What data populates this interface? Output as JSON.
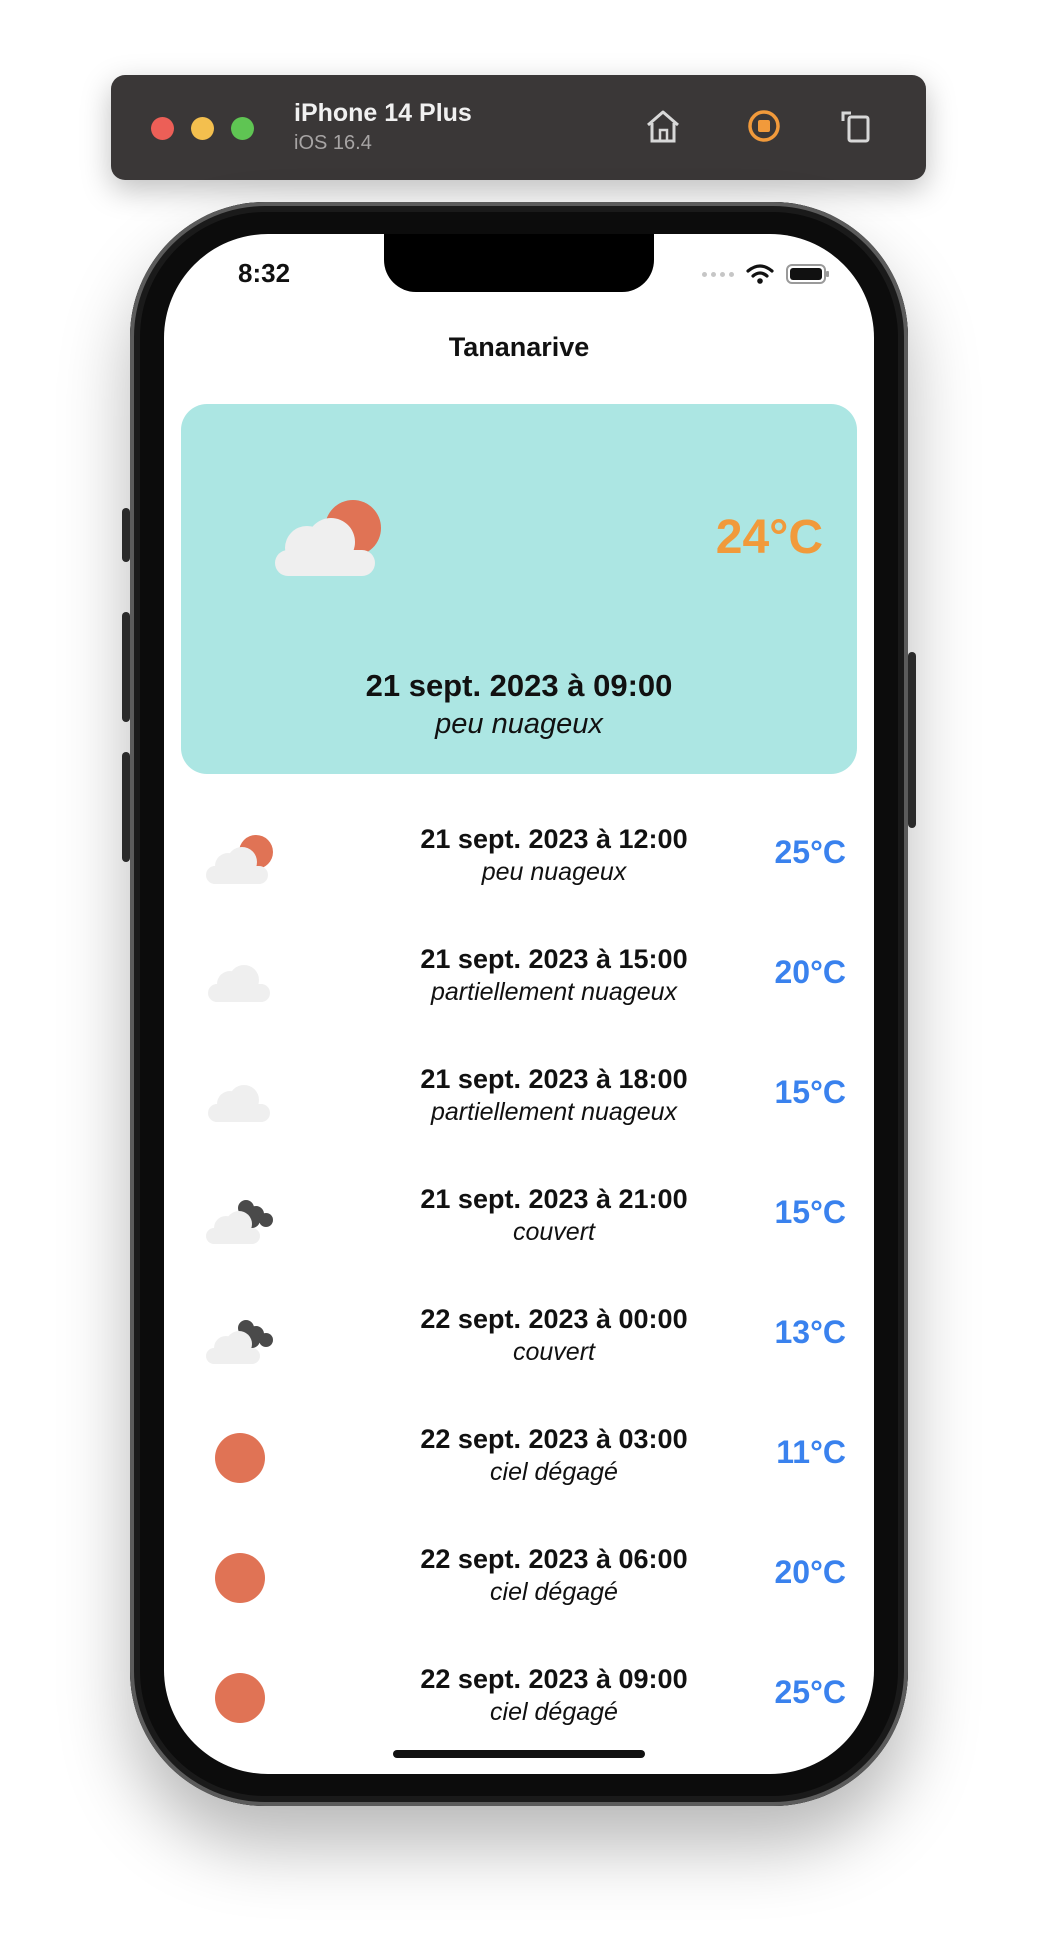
{
  "simulator": {
    "device": "iPhone 14 Plus",
    "os": "iOS 16.4",
    "icons": [
      "home-icon",
      "stop-record-icon",
      "rotate-icon"
    ],
    "accent": "#f19a3b"
  },
  "status_bar": {
    "time": "8:32"
  },
  "nav": {
    "title": "Tananarive"
  },
  "current": {
    "icon": "sun-behind-cloud-icon",
    "temperature": "24°C",
    "datetime": "21 sept. 2023 à 09:00",
    "description": "peu nuageux",
    "card_color": "#ace6e3"
  },
  "forecast": [
    {
      "icon": "sun-behind-cloud-icon",
      "datetime": "21 sept. 2023 à 12:00",
      "description": "peu nuageux",
      "temperature": "25°C"
    },
    {
      "icon": "cloud-icon",
      "datetime": "21 sept. 2023 à 15:00",
      "description": "partiellement nuageux",
      "temperature": "20°C"
    },
    {
      "icon": "cloud-icon",
      "datetime": "21 sept. 2023 à 18:00",
      "description": "partiellement nuageux",
      "temperature": "15°C"
    },
    {
      "icon": "overcast-icon",
      "datetime": "21 sept. 2023 à 21:00",
      "description": "couvert",
      "temperature": "15°C"
    },
    {
      "icon": "overcast-icon",
      "datetime": "22 sept. 2023 à 00:00",
      "description": "couvert",
      "temperature": "13°C"
    },
    {
      "icon": "sun-icon",
      "datetime": "22 sept. 2023 à 03:00",
      "description": "ciel dégagé",
      "temperature": "11°C"
    },
    {
      "icon": "sun-icon",
      "datetime": "22 sept. 2023 à 06:00",
      "description": "ciel dégagé",
      "temperature": "20°C"
    },
    {
      "icon": "sun-icon",
      "datetime": "22 sept. 2023 à 09:00",
      "description": "ciel dégagé",
      "temperature": "25°C"
    }
  ],
  "colors": {
    "temperature_list": "#3a82ee",
    "sun": "#e07355",
    "cloud": "#efefef",
    "dark_cloud": "#4a4a4a"
  }
}
